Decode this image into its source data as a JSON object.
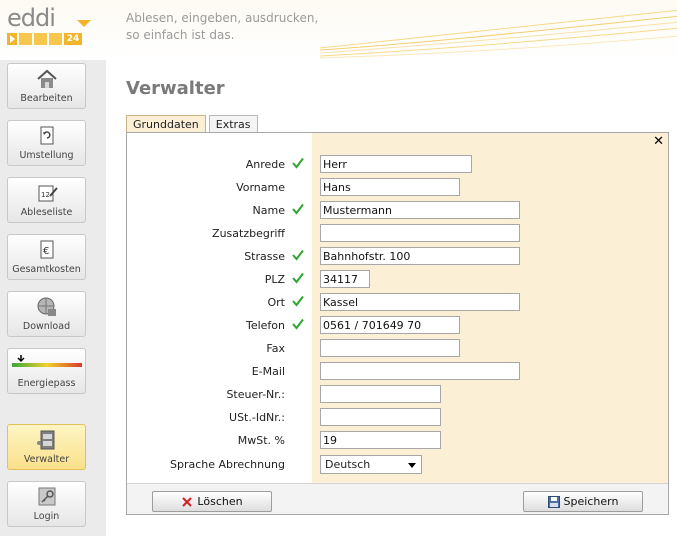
{
  "header": {
    "logo_text": "eddi",
    "logo_badge": "24",
    "tagline_line1": "Ablesen, eingeben, ausdrucken,",
    "tagline_line2": "so einfach ist das."
  },
  "sidebar": {
    "items": [
      {
        "label": "Bearbeiten",
        "icon": "house-icon"
      },
      {
        "label": "Umstellung",
        "icon": "refresh-document-icon"
      },
      {
        "label": "Ableseliste",
        "icon": "calendar-pen-icon"
      },
      {
        "label": "Gesamtkosten",
        "icon": "euro-document-icon"
      },
      {
        "label": "Download",
        "icon": "globe-download-icon"
      },
      {
        "label": "Energiepass",
        "icon": "energy-scale-icon"
      },
      {
        "label": "Verwalter",
        "icon": "cabinet-icon",
        "active": true
      },
      {
        "label": "Login",
        "icon": "key-icon"
      }
    ]
  },
  "main": {
    "title": "Verwalter",
    "tabs": [
      {
        "label": "Grunddaten",
        "active": true
      },
      {
        "label": "Extras",
        "active": false
      }
    ],
    "close_symbol": "✕"
  },
  "form": {
    "fields": [
      {
        "label": "Anrede",
        "value": "Herr",
        "checked": true
      },
      {
        "label": "Vorname",
        "value": "Hans",
        "checked": false
      },
      {
        "label": "Name",
        "value": "Mustermann",
        "checked": true
      },
      {
        "label": "Zusatzbegriff",
        "value": "",
        "checked": false
      },
      {
        "label": "Strasse",
        "value": "Bahnhofstr. 100",
        "checked": true
      },
      {
        "label": "PLZ",
        "value": "34117",
        "checked": true
      },
      {
        "label": "Ort",
        "value": "Kassel",
        "checked": true
      },
      {
        "label": "Telefon",
        "value": "0561 / 701649 70",
        "checked": true
      },
      {
        "label": "Fax",
        "value": "",
        "checked": false
      },
      {
        "label": "E-Mail",
        "value": "",
        "checked": false
      },
      {
        "label": "Steuer-Nr.:",
        "value": "",
        "checked": false
      },
      {
        "label": "USt.-IdNr.:",
        "value": "",
        "checked": false
      },
      {
        "label": "MwSt. %",
        "value": "19",
        "checked": false
      }
    ],
    "language": {
      "label": "Sprache Abrechnung",
      "selected": "Deutsch"
    }
  },
  "footer": {
    "delete_label": "Löschen",
    "save_label": "Speichern"
  },
  "colors": {
    "accent": "#f2b42a",
    "panel_bg": "#fbefd5",
    "check": "#2ea62e",
    "delete": "#d42020"
  }
}
